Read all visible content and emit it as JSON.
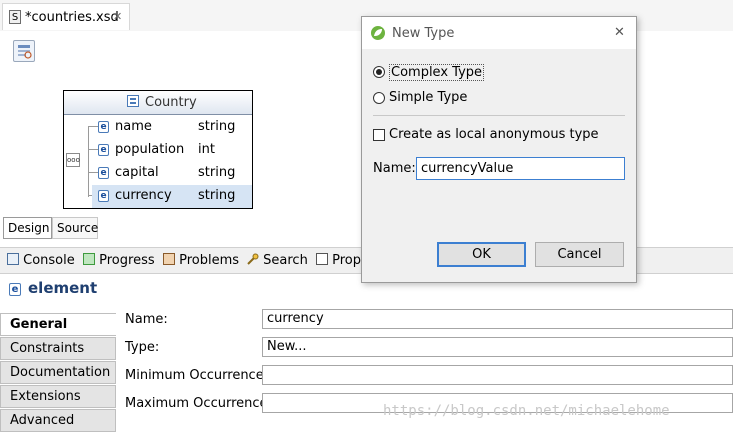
{
  "editor": {
    "tab_title": "*countries.xsd",
    "file_icon_letter": "S",
    "close_glyph": "✕"
  },
  "schema": {
    "box_title": "Country",
    "compositor_glyph": "ooo",
    "elements": [
      {
        "icon": "e",
        "name": "name",
        "type": "string"
      },
      {
        "icon": "e",
        "name": "population",
        "type": "int"
      },
      {
        "icon": "e",
        "name": "capital",
        "type": "string"
      },
      {
        "icon": "e",
        "name": "currency",
        "type": "string"
      }
    ]
  },
  "bottom_tabs": {
    "design": "Design",
    "source": "Source"
  },
  "views": {
    "console": "Console",
    "progress": "Progress",
    "problems": "Problems",
    "search": "Search",
    "properties": "Prop"
  },
  "properties": {
    "title": "element",
    "title_icon": "e",
    "tabs": [
      "General",
      "Constraints",
      "Documentation",
      "Extensions",
      "Advanced"
    ],
    "fields": {
      "name_label": "Name:",
      "name_value": "currency",
      "type_label": "Type:",
      "type_value": "New...",
      "min_label": "Minimum Occurrence:",
      "min_value": "",
      "max_label": "Maximum Occurrence:",
      "max_value": ""
    }
  },
  "dialog": {
    "title": "New Type",
    "close_glyph": "✕",
    "complex_type": "Complex Type",
    "simple_type": "Simple Type",
    "local_anonymous": "Create as local anonymous type",
    "name_label": "Name:",
    "name_value": "currencyValue",
    "ok_label": "OK",
    "cancel_label": "Cancel"
  },
  "watermark": "https://blog.csdn.net/michaelehome",
  "colors": {
    "accent": "#3c7fd1",
    "element_icon": "#1b4f9c",
    "selected_row": "#d6e4f4"
  }
}
